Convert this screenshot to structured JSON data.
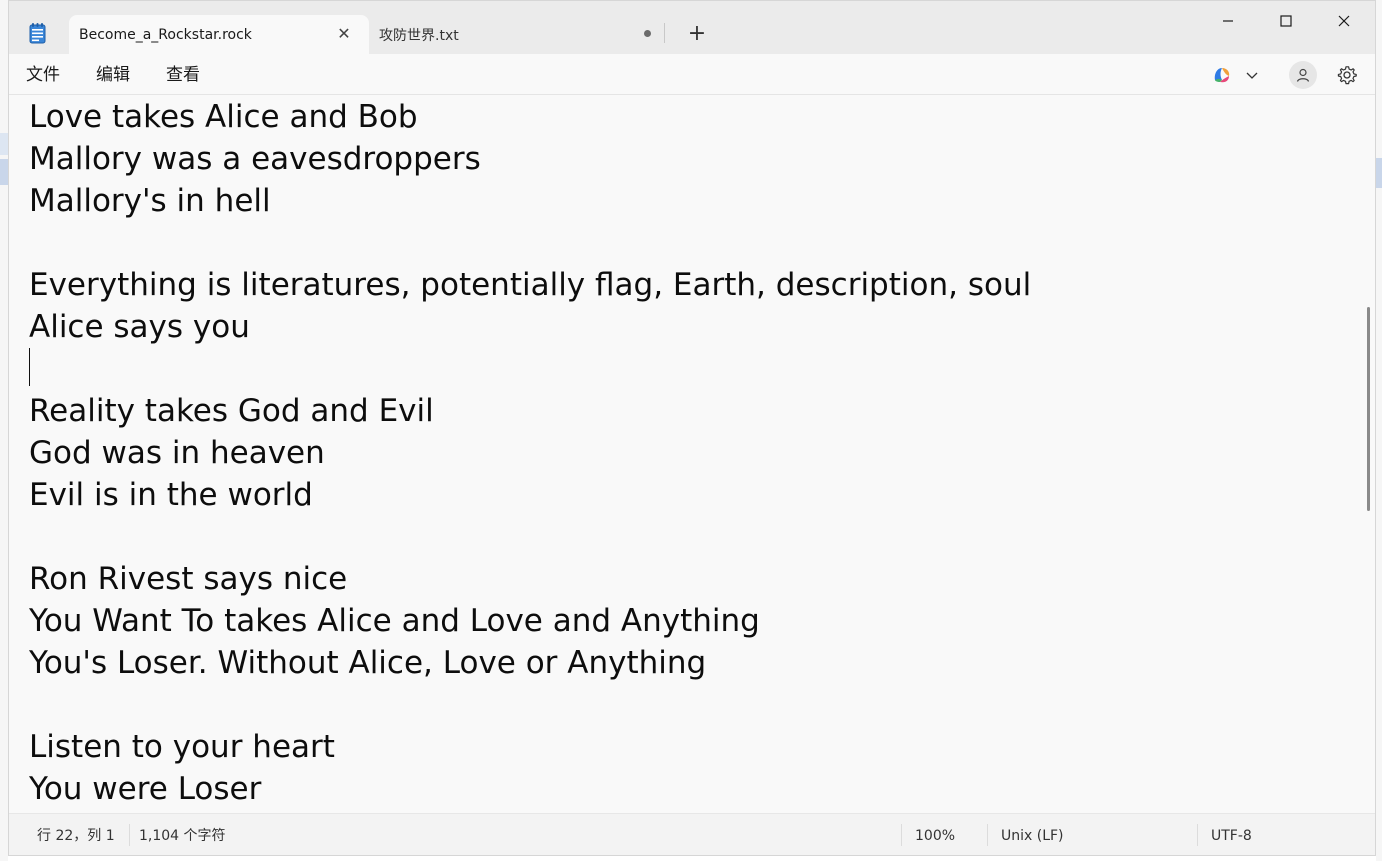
{
  "tabs": [
    {
      "title": "Become_a_Rockstar.rock",
      "active": true,
      "close_glyph": "✕"
    },
    {
      "title": "攻防世界.txt",
      "active": false,
      "unsaved": true
    }
  ],
  "new_tab_glyph": "+",
  "menu": {
    "file": "文件",
    "edit": "编辑",
    "view": "查看"
  },
  "editor": {
    "lines": [
      "Love takes Alice and Bob",
      "Mallory was a eavesdroppers",
      "Mallory's in hell",
      "",
      "Everything is literatures, potentially flag, Earth, description, soul",
      "Alice says you",
      "",
      "Reality takes God and Evil",
      "God was in heaven",
      "Evil is in the world",
      "",
      "Ron Rivest says nice",
      "You Want To takes Alice and Love and Anything",
      "You's Loser. Without Alice, Love or Anything",
      "",
      "Listen to your heart",
      "You were Loser"
    ]
  },
  "status": {
    "position": "行 22，列 1",
    "char_count": "1,104 个字符",
    "zoom": "100%",
    "line_ending": "Unix (LF)",
    "encoding": "UTF-8"
  },
  "icons": {
    "app": "notepad-icon",
    "copilot": "copilot-icon",
    "account": "account-icon",
    "settings": "gear-icon"
  },
  "colors": {
    "titlebar": "#ebebeb",
    "editor_bg": "#f9f9f9",
    "text": "#0d0d0d",
    "app_icon_blue": "#2b79d0"
  }
}
